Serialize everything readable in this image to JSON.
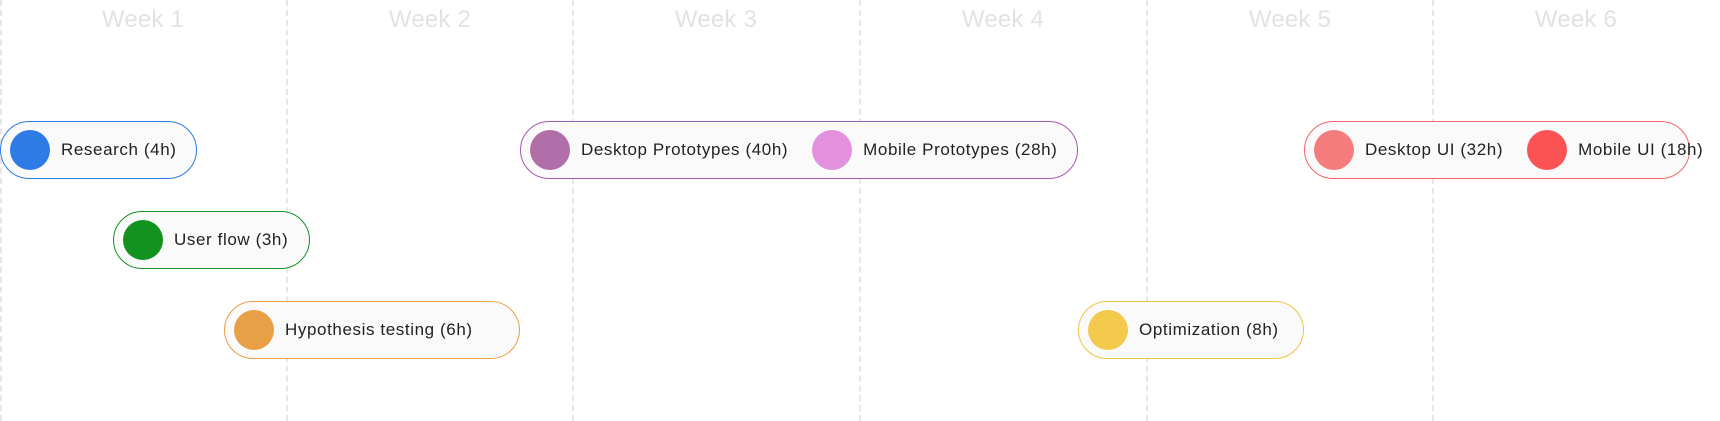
{
  "weeks": [
    "Week 1",
    "Week 2",
    "Week 3",
    "Week 4",
    "Week 5",
    "Week 6"
  ],
  "groups": {
    "research": {
      "border_color": "#2e7be6",
      "tasks": [
        {
          "label": "Research (4h)",
          "color": "#2e7be6"
        }
      ]
    },
    "user_flow": {
      "border_color": "#12921f",
      "tasks": [
        {
          "label": "User flow (3h)",
          "color": "#12921f"
        }
      ]
    },
    "hypothesis": {
      "border_color": "#e89f45",
      "tasks": [
        {
          "label": "Hypothesis testing (6h)",
          "color": "#e89f45"
        }
      ]
    },
    "prototypes": {
      "border_color": "#a559b3",
      "tasks": [
        {
          "label": "Desktop Prototypes (40h)",
          "color": "#b06fa8"
        },
        {
          "label": "Mobile Prototypes (28h)",
          "color": "#e390dd"
        }
      ]
    },
    "optimization": {
      "border_color": "#f0c442",
      "tasks": [
        {
          "label": "Optimization (8h)",
          "color": "#f3c94c"
        }
      ]
    },
    "ui": {
      "border_color": "#f1666c",
      "tasks": [
        {
          "label": "Desktop UI (32h)",
          "color": "#f47c7d"
        },
        {
          "label": "Mobile UI (18h)",
          "color": "#fb5253"
        }
      ]
    }
  }
}
